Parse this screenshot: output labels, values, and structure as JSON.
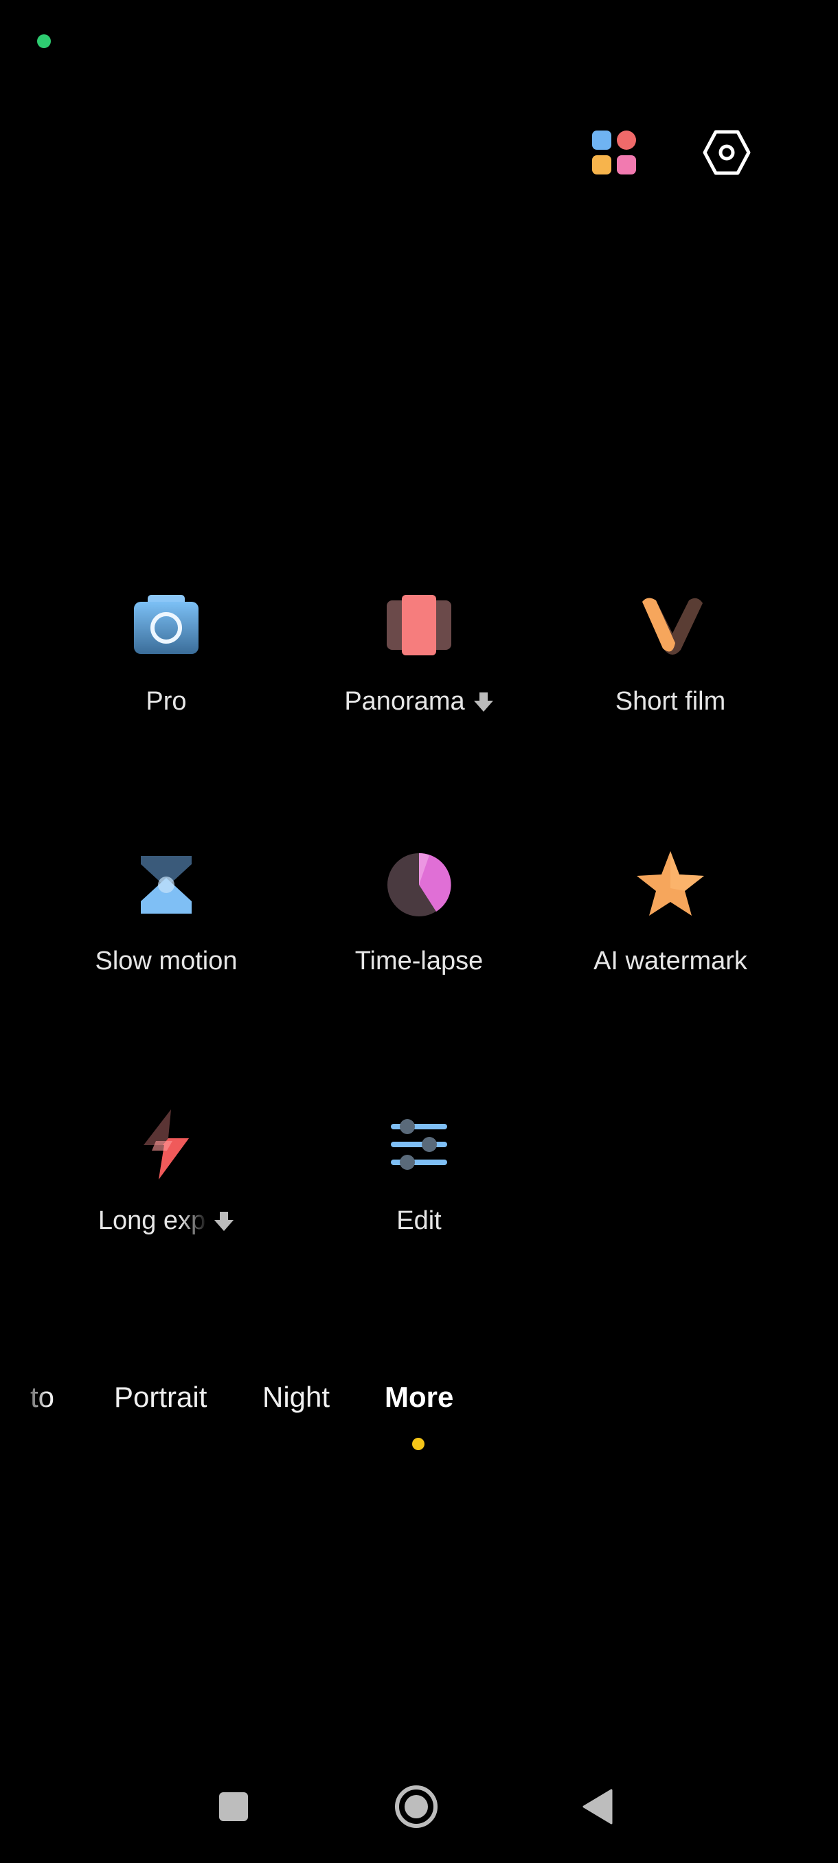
{
  "status": {
    "privacy_indicator_color": "#2ecc71"
  },
  "top_bar": {
    "apps_icon": "apps-grid-icon",
    "settings_icon": "settings-hexagon-icon"
  },
  "modes": [
    {
      "label": "Pro",
      "icon": "pro-camera-icon",
      "download": false
    },
    {
      "label": "Panorama",
      "icon": "panorama-icon",
      "download": true
    },
    {
      "label": "Short film",
      "icon": "short-film-icon",
      "download": false
    },
    {
      "label": "Slow motion",
      "icon": "slow-motion-icon",
      "download": false
    },
    {
      "label": "Time-lapse",
      "icon": "time-lapse-icon",
      "download": false
    },
    {
      "label": "AI watermark",
      "icon": "ai-watermark-icon",
      "download": false
    },
    {
      "label": "Long exp",
      "icon": "long-exposure-icon",
      "download": true
    },
    {
      "label": "Edit",
      "icon": "edit-sliders-icon",
      "download": false
    }
  ],
  "mode_strip": {
    "items": [
      "to",
      "Portrait",
      "Night",
      "More"
    ],
    "active": "More",
    "active_indicator_color": "#f5c518"
  },
  "nav": {
    "recents": "square-icon",
    "home": "circle-icon",
    "back": "triangle-back-icon"
  }
}
